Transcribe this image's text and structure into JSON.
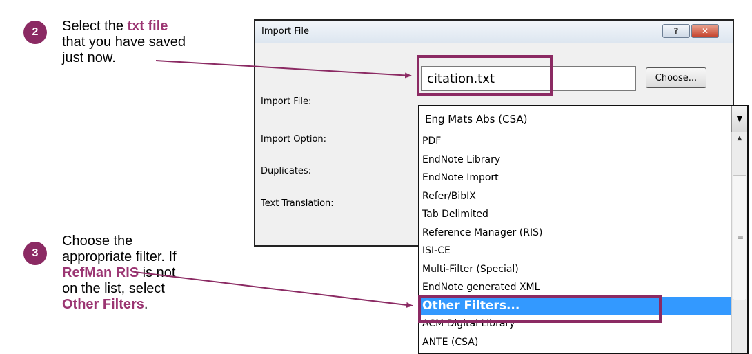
{
  "steps": [
    {
      "number": "2",
      "lines": [
        {
          "before": "Select the ",
          "highlight": "txt file",
          "after": ""
        },
        {
          "before": "that you have saved",
          "highlight": "",
          "after": ""
        },
        {
          "before": "just now.",
          "highlight": "",
          "after": ""
        }
      ]
    },
    {
      "number": "3",
      "lines": [
        {
          "before": "Choose the",
          "highlight": "",
          "after": ""
        },
        {
          "before": "appropriate filter.  If",
          "highlight": "",
          "after": ""
        },
        {
          "before": "",
          "highlight": "RefMan RIS",
          "after": " is not"
        },
        {
          "before": "on the list, select",
          "highlight": "",
          "after": ""
        },
        {
          "before": "",
          "highlight": "Other Filters",
          "after": "."
        }
      ]
    }
  ],
  "dialog": {
    "title": "Import File",
    "help_label": "?",
    "close_label": "✕",
    "labels": {
      "import_file": "Import File:",
      "import_option": "Import Option:",
      "duplicates": "Duplicates:",
      "text_translation": "Text Translation:"
    },
    "import_file_value": "citation.txt",
    "choose_label": "Choose...",
    "import_option_value": "Eng Mats Abs (CSA)",
    "options": [
      "PDF",
      "EndNote Library",
      "EndNote Import",
      "Refer/BibIX",
      "Tab Delimited",
      "Reference Manager (RIS)",
      "ISI-CE",
      "Multi-Filter (Special)",
      "EndNote generated XML",
      "Other Filters...",
      "ACM Digital Library",
      "ANTE (CSA)"
    ],
    "selected_option": "Other Filters..."
  },
  "colors": {
    "accent": "#8b2a63",
    "highlight_text": "#9b3572",
    "selection": "#3399ff"
  }
}
